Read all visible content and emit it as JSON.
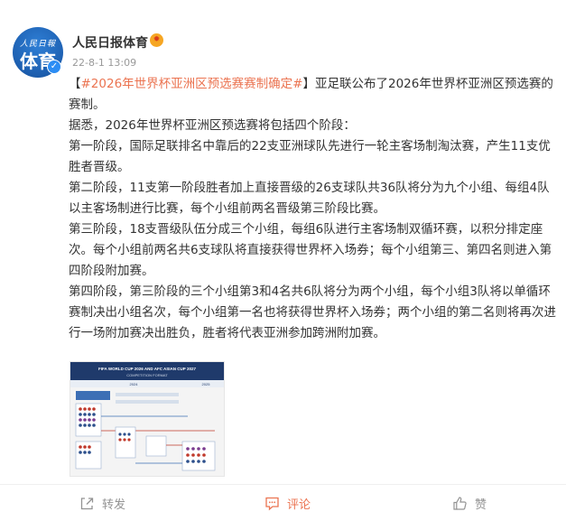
{
  "account": {
    "avatar_lines": [
      "人民日報",
      "体育"
    ],
    "name": "人民日报体育",
    "verified_symbol": "✓",
    "badge_symbol": "✹",
    "time": "22-8-1 13:09"
  },
  "post": {
    "bracket_open": "【",
    "hashtag": "#2026年世界杯亚洲区预选赛赛制确定#",
    "bracket_close": "】",
    "headline_rest": "亚足联公布了2026年世界杯亚洲区预选赛的赛制。",
    "paragraphs": [
      "据悉，2026年世界杯亚洲区预选赛将包括四个阶段：",
      "第一阶段，国际足联排名中靠后的22支亚洲球队先进行一轮主客场制淘汰赛，产生11支优胜者晋级。",
      "第二阶段，11支第一阶段胜者加上直接晋级的26支球队共36队将分为九个小组、每组4队以主客场制进行比赛，每个小组前两名晋级第三阶段比赛。",
      "第三阶段，18支晋级队伍分成三个小组，每组6队进行主客场制双循环赛，以积分排定座次。每个小组前两名共6支球队将直接获得世界杯入场券；每个小组第三、第四名则进入第四阶段附加赛。",
      "第四阶段，第三阶段的三个小组第3和4名共6队将分为两个小组，每个小组3队将以单循环赛制决出小组名次，每个小组第一名也将获得世界杯入场券；两个小组的第二名则将再次进行一场附加赛决出胜负，胜者将代表亚洲参加跨洲附加赛。"
    ]
  },
  "image": {
    "header_text": "FIFA WORLD CUP 2026 AND AFC ASIAN CUP 2027",
    "subtitle": "COMPETITION FORMAT",
    "year_left": "2024",
    "year_right": "2025"
  },
  "actions": {
    "share_label": "转发",
    "comment_label": "评论",
    "like_label": "赞"
  },
  "colors": {
    "accent": "#eb7350",
    "verified": "#2c8df4",
    "avatar": "#1d5fb0",
    "muted": "#939393",
    "text": "#333333"
  },
  "icons": {
    "share": "share-icon",
    "comment": "comment-icon",
    "like": "thumbs-up-icon",
    "verified": "verified-check-icon",
    "badge": "member-badge-icon"
  }
}
